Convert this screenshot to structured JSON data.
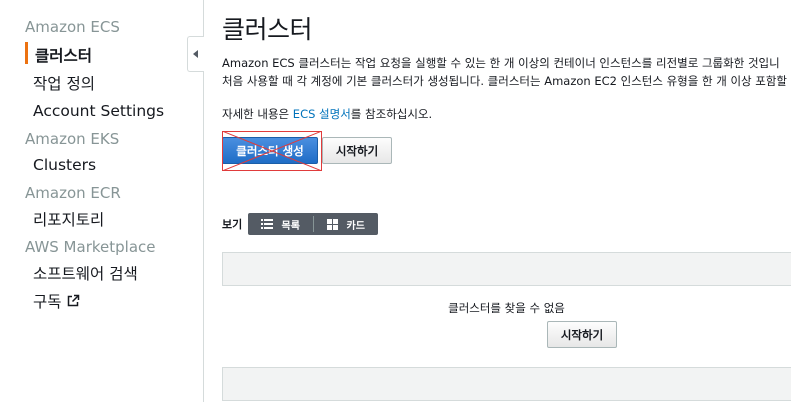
{
  "sidebar": {
    "groups": [
      {
        "label": "Amazon ECS",
        "items": [
          "클러스터",
          "작업 정의",
          "Account Settings"
        ]
      },
      {
        "label": "Amazon EKS",
        "items": [
          "Clusters"
        ]
      },
      {
        "label": "Amazon ECR",
        "items": [
          "리포지토리"
        ]
      },
      {
        "label": "AWS Marketplace",
        "items": [
          "소프트웨어 검색",
          "구독"
        ]
      }
    ],
    "active_item": "클러스터"
  },
  "main": {
    "title": "클러스터",
    "description_line1": "Amazon ECS 클러스터는 작업 요청을 실행할 수 있는 한 개 이상의 컨테이너 인스턴스를 리전별로 그룹화한 것입니",
    "description_line2": "처음 사용할 때 각 계정에 기본 클러스터가 생성됩니다. 클러스터는 Amazon EC2 인스턴스 유형을 한 개 이상 포함할",
    "docs_prefix": "자세한 내용은 ",
    "docs_link": "ECS 설명서",
    "docs_suffix": "를 참조하십시오.",
    "create_button": "클러스터 생성",
    "get_started_button": "시작하기",
    "view_label": "보기",
    "view_list": "목록",
    "view_card": "카드",
    "empty_message": "클러스터를 찾을 수 없음",
    "empty_get_started": "시작하기"
  },
  "colors": {
    "accent_active": "#ec7211",
    "link": "#0073bb",
    "primary_button": "#1f6dc6",
    "annotation": "#e03b3b"
  }
}
